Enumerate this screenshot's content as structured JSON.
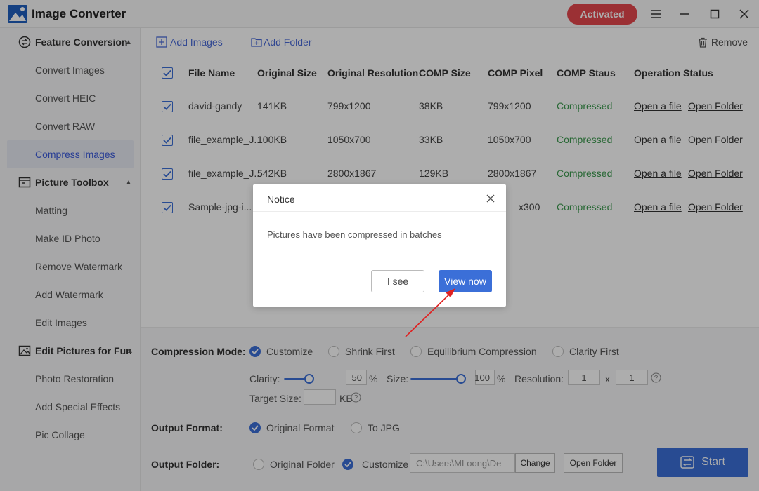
{
  "app": {
    "title": "Image Converter",
    "activated_label": "Activated"
  },
  "sidebar": {
    "groups": [
      {
        "label": "Feature Conversion",
        "items": [
          "Convert Images",
          "Convert HEIC",
          "Convert RAW",
          "Compress Images"
        ]
      },
      {
        "label": "Picture Toolbox",
        "items": [
          "Matting",
          "Make ID Photo",
          "Remove Watermark",
          "Add Watermark",
          "Edit Images"
        ]
      },
      {
        "label": "Edit Pictures for Fun",
        "items": [
          "Photo Restoration",
          "Add Special Effects",
          "Pic Collage"
        ]
      }
    ],
    "active_item": "Compress Images"
  },
  "toolbar": {
    "add_images": "Add Images",
    "add_folder": "Add Folder",
    "remove": "Remove"
  },
  "table": {
    "headers": [
      "File Name",
      "Original Size",
      "Original Resolution",
      "COMP Size",
      "COMP Pixel",
      "COMP Staus",
      "Operation Status"
    ],
    "rows": [
      {
        "name": "david-gandy",
        "size": "141KB",
        "res": "799x1200",
        "comp_size": "38KB",
        "comp_pixel": "799x1200",
        "status": "Compressed",
        "open_file": "Open a file",
        "open_folder": "Open Folder"
      },
      {
        "name": "file_example_J...",
        "size": "100KB",
        "res": "1050x700",
        "comp_size": "33KB",
        "comp_pixel": "1050x700",
        "status": "Compressed",
        "open_file": "Open a file",
        "open_folder": "Open Folder"
      },
      {
        "name": "file_example_J...",
        "size": "542KB",
        "res": "2800x1867",
        "comp_size": "129KB",
        "comp_pixel": "2800x1867",
        "status": "Compressed",
        "open_file": "Open a file",
        "open_folder": "Open Folder"
      },
      {
        "name": "Sample-jpg-i...",
        "size": "",
        "res": "",
        "comp_size": "",
        "comp_pixel": "x300",
        "status": "Compressed",
        "open_file": "Open a file",
        "open_folder": "Open Folder"
      }
    ]
  },
  "settings": {
    "compression_mode_label": "Compression Mode:",
    "modes": [
      "Customize",
      "Shrink First",
      "Equilibrium Compression",
      "Clarity First"
    ],
    "clarity_label": "Clarity:",
    "clarity_value": "50",
    "clarity_level": 0.5,
    "percent": "%",
    "size_label": "Size:",
    "size_value": "100",
    "size_level": 1.0,
    "resolution_label": "Resolution:",
    "res_w": "1",
    "res_x": "x",
    "res_h": "1",
    "target_size_label": "Target Size:",
    "target_unit": "KB",
    "output_format_label": "Output Format:",
    "formats": [
      "Original Format",
      "To JPG"
    ],
    "output_folder_label": "Output Folder:",
    "folders": [
      "Original Folder",
      "Customize"
    ],
    "path": "C:\\Users\\MLoong\\De",
    "change": "Change",
    "open_folder": "Open Folder",
    "start": "Start"
  },
  "dialog": {
    "title": "Notice",
    "message": "Pictures have been compressed in batches",
    "i_see": "I see",
    "view_now": "View now"
  },
  "colors": {
    "accent": "#3b6fd8",
    "activated": "#e5484d",
    "compressed": "#3c9a4e",
    "annotation": "#e02020"
  }
}
